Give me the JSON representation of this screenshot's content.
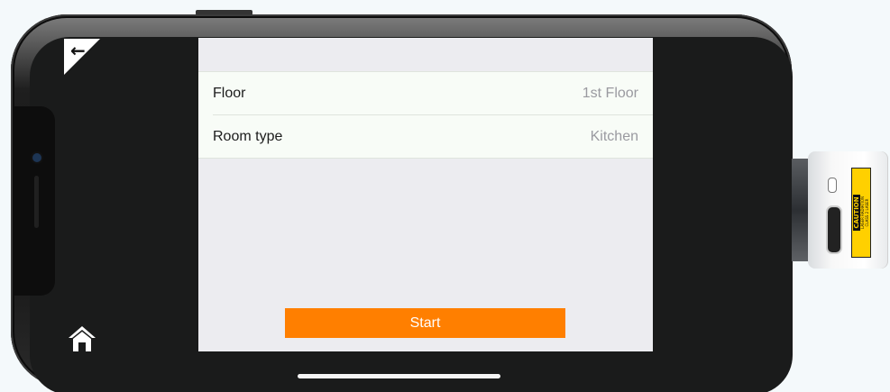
{
  "app": {
    "rows": [
      {
        "label": "Floor",
        "value": "1st Floor"
      },
      {
        "label": "Room type",
        "value": "Kitchen"
      }
    ],
    "start_label": "Start"
  },
  "nav": {
    "back_icon": "arrow-left-icon",
    "home_icon": "home-icon"
  },
  "device": {
    "label_title": "CAUTION",
    "label_sub": "LASER RADIATION",
    "label_class": "CLASS 2 LASER"
  },
  "colors": {
    "accent": "#ff7f00",
    "screen_bg": "#1a1b1b",
    "panel_bg": "#ececf0",
    "list_bg": "#f8fcf7",
    "value_text": "#9a9aa0",
    "caution_yellow": "#ffd000"
  }
}
